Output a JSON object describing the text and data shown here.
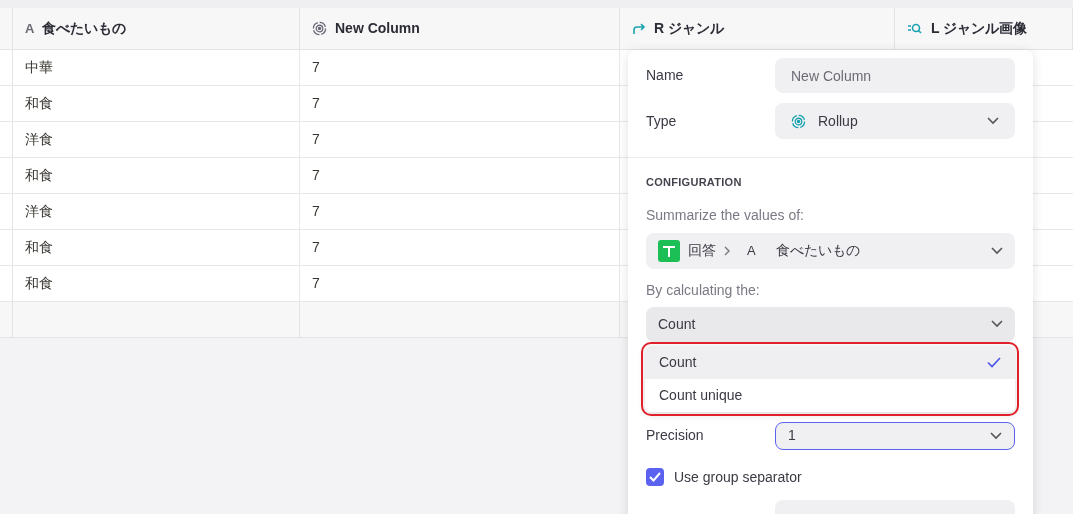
{
  "table": {
    "columns": [
      {
        "label": "食べたいもの",
        "kind": "text",
        "icon": "A"
      },
      {
        "label": "New Column",
        "kind": "rollup"
      },
      {
        "label": "R ジャンル",
        "kind": "link"
      },
      {
        "label": "L ジャンル画像",
        "kind": "lookup"
      }
    ],
    "rows": [
      [
        "中華",
        "7"
      ],
      [
        "和食",
        "7"
      ],
      [
        "洋食",
        "7"
      ],
      [
        "和食",
        "7"
      ],
      [
        "洋食",
        "7"
      ],
      [
        "和食",
        "7"
      ],
      [
        "和食",
        "7"
      ]
    ]
  },
  "panel": {
    "name": {
      "label": "Name",
      "placeholder": "New Column"
    },
    "type": {
      "label": "Type",
      "value": "Rollup"
    },
    "section": "CONFIGURATION",
    "summarize": {
      "label": "Summarize the values of:",
      "table": "回答",
      "column_icon": "A",
      "column": "食べたいもの"
    },
    "calc": {
      "label": "By calculating the:",
      "value": "Count",
      "options": [
        {
          "label": "Count",
          "selected": true
        },
        {
          "label": "Count unique",
          "selected": false
        }
      ]
    },
    "precision": {
      "label": "Precision",
      "value": "1"
    },
    "group_separator": {
      "label": "Use group separator",
      "checked": true
    }
  }
}
